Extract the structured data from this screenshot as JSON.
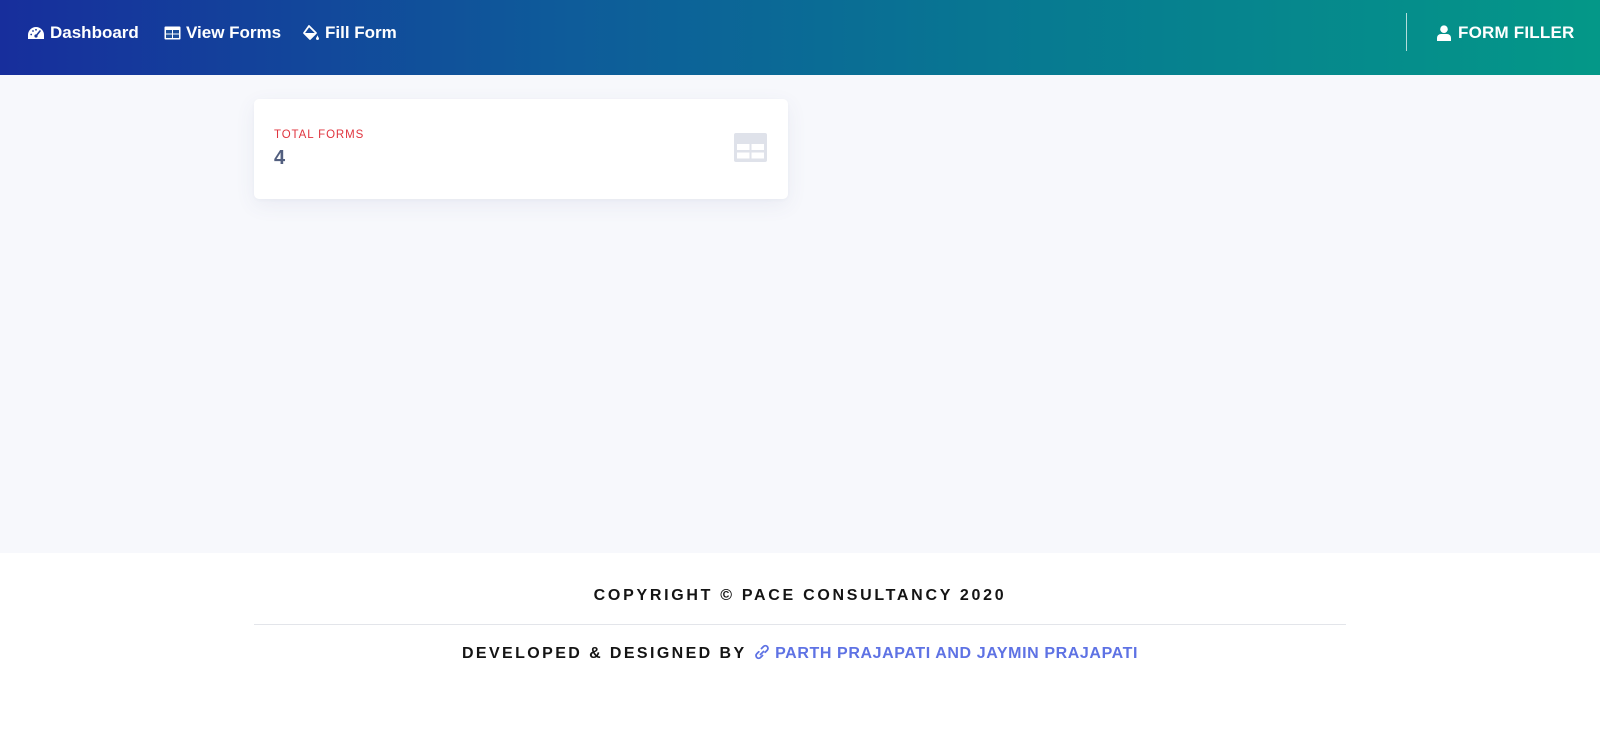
{
  "nav": {
    "dashboard": {
      "label": "Dashboard",
      "icon": "speedometer-icon"
    },
    "view_forms": {
      "label": "View Forms",
      "icon": "table-icon"
    },
    "fill_form": {
      "label": "Fill Form",
      "icon": "paint-bucket-icon"
    },
    "user": {
      "label": "FORM FILLER",
      "icon": "user-icon"
    }
  },
  "stats": {
    "total_forms": {
      "label": "TOTAL FORMS",
      "value": "4",
      "icon": "table-icon"
    }
  },
  "footer": {
    "copyright": "COPYRIGHT © PACE CONSULTANCY 2020",
    "credits_prefix": "DEVELOPED & DESIGNED BY",
    "credits_link": "PARTH PRAJAPATI AND JAYMIN PRAJAPATI",
    "credits_icon": "link-icon"
  },
  "colors": {
    "header_gradient_start": "#172e9c",
    "header_gradient_end": "#049888",
    "stat_label": "#e0353f",
    "stat_value": "#525f7f",
    "link": "#5e72e4",
    "content_bg": "#f7f8fc"
  }
}
